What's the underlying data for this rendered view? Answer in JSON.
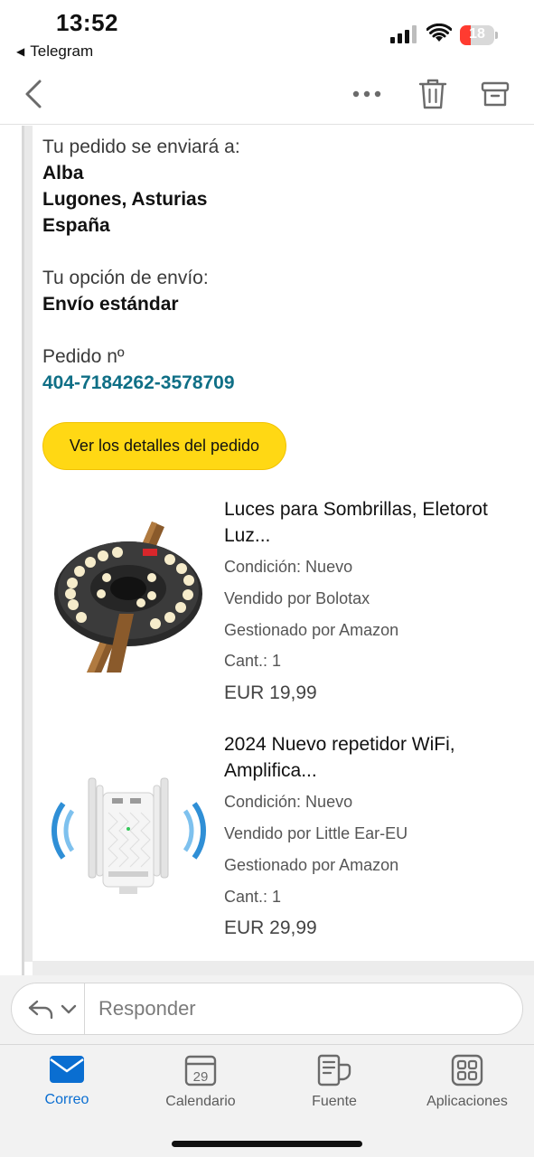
{
  "status_bar": {
    "time": "13:52",
    "back_app": "Telegram",
    "battery": "18",
    "battery_color": "#ff3b30"
  },
  "nav": {
    "icons": [
      "chevron-left-icon",
      "more-icon",
      "trash-icon",
      "archive-icon"
    ]
  },
  "shipping": {
    "ship_to_label": "Tu pedido se enviará a:",
    "name": "Alba",
    "city": "Lugones, Asturias",
    "country": "España",
    "option_label": "Tu opción de envío:",
    "option": "Envío estándar",
    "order_label": "Pedido nº",
    "order_number": "404-7184262-3578709",
    "details_button": "Ver los detalles del pedido"
  },
  "products": [
    {
      "title_line1": "Luces para Sombrillas, Eletorot",
      "title_line2": "Luz...",
      "condition": "Condición: Nuevo",
      "seller": "Vendido por Bolotax",
      "managed": "Gestionado por Amazon",
      "qty": "Cant.: 1",
      "price": "EUR 19,99"
    },
    {
      "title_line1": "2024 Nuevo repetidor WiFi,",
      "title_line2": "Amplifica...",
      "condition": "Condición: Nuevo",
      "seller": "Vendido por Little Ear-EU",
      "managed": "Gestionado por Amazon",
      "qty": "Cant.: 1",
      "price": "EUR 29,99"
    }
  ],
  "reply": {
    "placeholder": "Responder"
  },
  "tabs": [
    {
      "label": "Correo",
      "icon": "mail-icon",
      "active": true
    },
    {
      "label": "Calendario",
      "icon": "calendar-icon",
      "day": "29"
    },
    {
      "label": "Fuente",
      "icon": "feed-icon"
    },
    {
      "label": "Aplicaciones",
      "icon": "apps-icon"
    }
  ],
  "colors": {
    "accent": "#0a6ed1",
    "cta": "#ffd814",
    "link": "#0f6f86"
  }
}
